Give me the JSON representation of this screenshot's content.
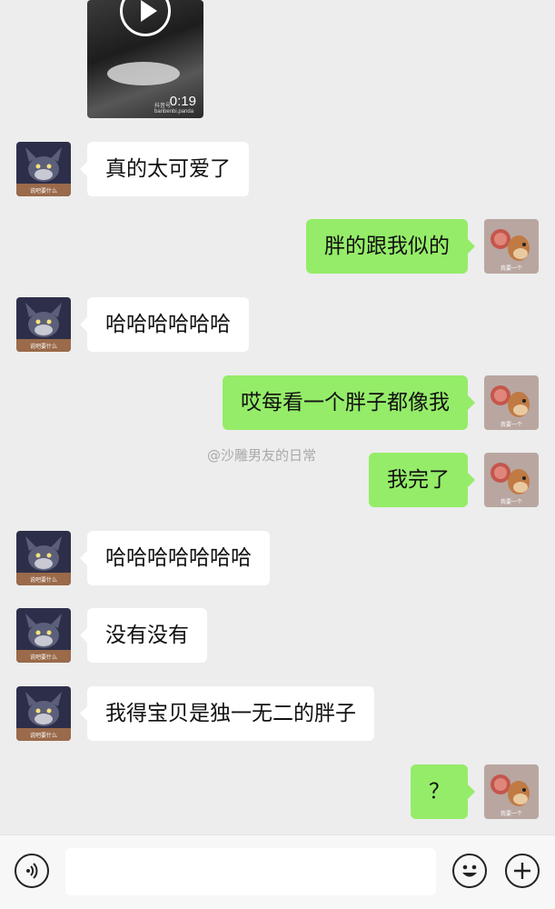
{
  "chat": {
    "video": {
      "duration": "0:19",
      "watermark": "抖音号: banbenbi.panda"
    },
    "messages": [
      {
        "side": "left",
        "text": "真的太可爱了"
      },
      {
        "side": "right",
        "text": "胖的跟我似的"
      },
      {
        "side": "left",
        "text": "哈哈哈哈哈哈"
      },
      {
        "side": "right",
        "text": "哎每看一个胖子都像我"
      },
      {
        "side": "right",
        "text": "我完了"
      },
      {
        "side": "left",
        "text": "哈哈哈哈哈哈哈"
      },
      {
        "side": "left",
        "text": "没有没有"
      },
      {
        "side": "left",
        "text": "我得宝贝是独一无二的胖子"
      },
      {
        "side": "right",
        "text": "？"
      }
    ],
    "watermark": "@沙雕男友的日常"
  },
  "avatars": {
    "left_caption": "说吧要什么",
    "right_caption": "我要一个"
  },
  "toolbar": {
    "voice_icon": "voice-icon",
    "emoji_icon": "emoji-icon",
    "plus_icon": "plus-icon"
  },
  "colors": {
    "sent_bubble": "#95ec69",
    "received_bubble": "#ffffff",
    "background": "#ededed"
  }
}
